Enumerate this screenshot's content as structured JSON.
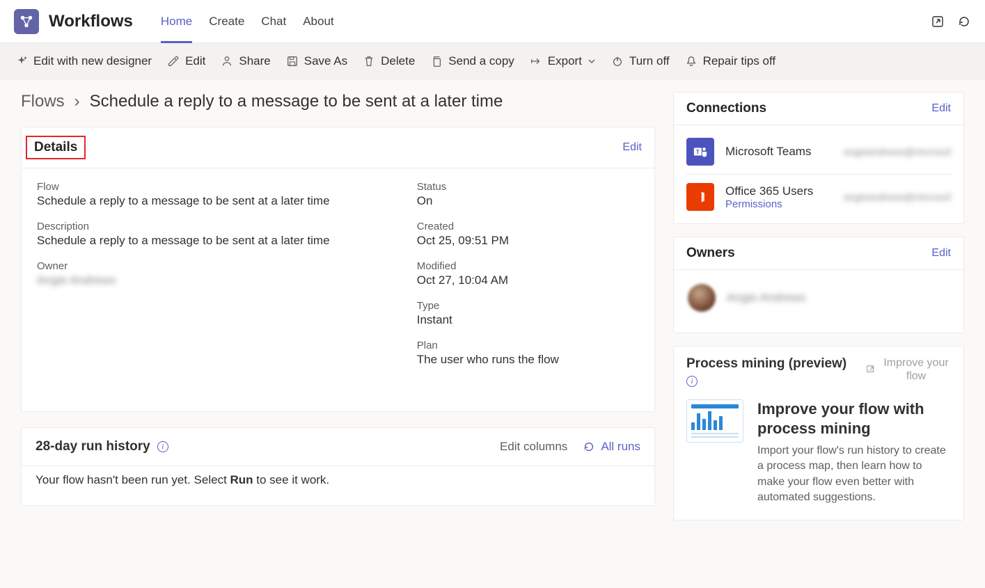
{
  "header": {
    "app_title": "Workflows",
    "nav": [
      {
        "label": "Home",
        "active": true
      },
      {
        "label": "Create",
        "active": false
      },
      {
        "label": "Chat",
        "active": false
      },
      {
        "label": "About",
        "active": false
      }
    ]
  },
  "toolbar": {
    "edit_new_designer": "Edit with new designer",
    "edit": "Edit",
    "share": "Share",
    "save_as": "Save As",
    "delete": "Delete",
    "send_copy": "Send a copy",
    "export": "Export",
    "turn_off": "Turn off",
    "repair_tips": "Repair tips off"
  },
  "breadcrumb": {
    "root": "Flows",
    "current": "Schedule a reply to a message to be sent at a later time"
  },
  "details": {
    "card_title": "Details",
    "edit_label": "Edit",
    "fields_left": {
      "flow_label": "Flow",
      "flow_value": "Schedule a reply to a message to be sent at a later time",
      "description_label": "Description",
      "description_value": "Schedule a reply to a message to be sent at a later time",
      "owner_label": "Owner",
      "owner_value": "Angie Andrews"
    },
    "fields_right": {
      "status_label": "Status",
      "status_value": "On",
      "created_label": "Created",
      "created_value": "Oct 25, 09:51 PM",
      "modified_label": "Modified",
      "modified_value": "Oct 27, 10:04 AM",
      "type_label": "Type",
      "type_value": "Instant",
      "plan_label": "Plan",
      "plan_value": "The user who runs the flow"
    }
  },
  "run_history": {
    "title": "28-day run history",
    "edit_columns": "Edit columns",
    "all_runs": "All runs",
    "empty_prefix": "Your flow hasn't been run yet. Select ",
    "empty_bold": "Run",
    "empty_suffix": " to see it work."
  },
  "connections": {
    "title": "Connections",
    "edit_label": "Edit",
    "items": [
      {
        "name": "Microsoft Teams",
        "email": "angieandrews@microsof",
        "icon": "teams",
        "permissions": null
      },
      {
        "name": "Office 365 Users",
        "email": "angieandrews@microsof",
        "icon": "office",
        "permissions": "Permissions"
      }
    ]
  },
  "owners": {
    "title": "Owners",
    "edit_label": "Edit",
    "owner_name": "Angie Andrews"
  },
  "process_mining": {
    "title": "Process mining (preview)",
    "improve_link": "Improve your flow",
    "heading": "Improve your flow with process mining",
    "description": "Import your flow's run history to create a process map, then learn how to make your flow even better with automated suggestions."
  }
}
